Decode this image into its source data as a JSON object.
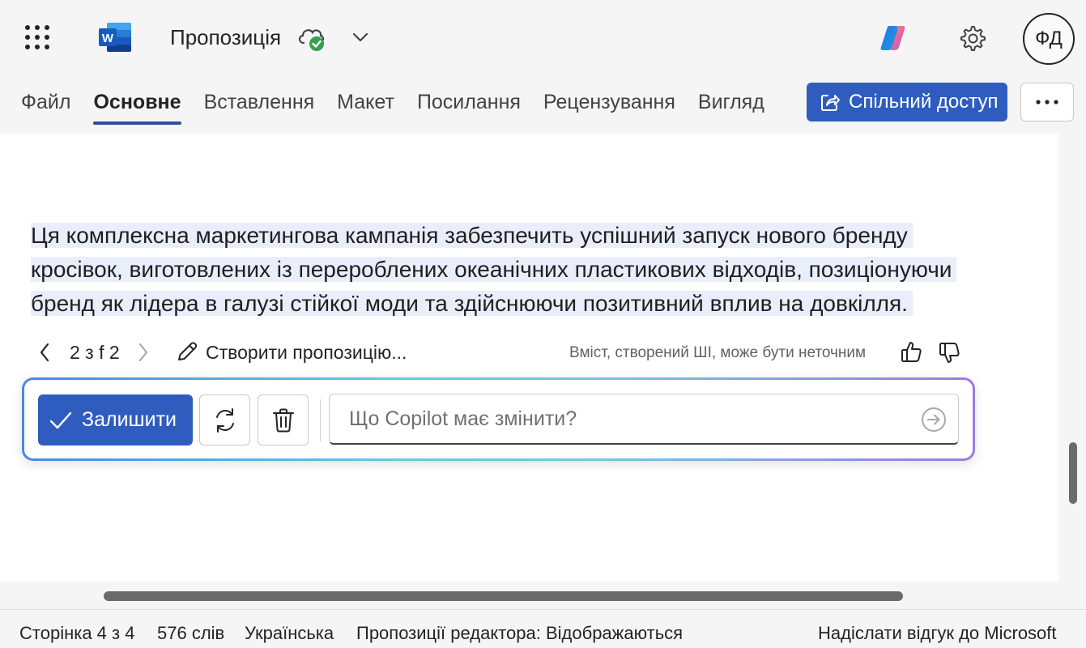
{
  "app": {
    "doc_title": "Пропозиція",
    "user_initials": "ФД"
  },
  "ribbon": {
    "tabs": [
      {
        "label": "Файл",
        "active": false
      },
      {
        "label": "Основне",
        "active": true
      },
      {
        "label": "Вставлення",
        "active": false
      },
      {
        "label": "Макет",
        "active": false
      },
      {
        "label": "Посилання",
        "active": false
      },
      {
        "label": "Рецензування",
        "active": false
      },
      {
        "label": "Вигляд",
        "active": false
      }
    ],
    "share_label": "Спільний доступ"
  },
  "document": {
    "paragraph_lines": [
      "Ця комплексна маркетингова кампанія забезпечить успішний запуск нового бренду",
      "кросівок, виготовлених із перероблених океанічних пластикових відходів, позиціонуючи",
      "бренд як лідера в галузі стійкої моди та здійснюючи позитивний вплив на довкілля."
    ]
  },
  "suggestion_nav": {
    "counter": "2 з f 2",
    "create_label": "Створити пропозицію...",
    "disclaimer": "Вміст, створений ШІ, може бути неточним"
  },
  "copilot_bar": {
    "keep_label": "Залишити",
    "input_placeholder": "Що Copilot має змінити?",
    "input_value": ""
  },
  "status": {
    "page": "Сторінка 4 з 4",
    "words": "576 слів",
    "language": "Українська",
    "editor": "Пропозиції редактора: Відображаються",
    "feedback": "Надіслати відгук до Microsoft"
  },
  "colors": {
    "accent": "#2f5dbf",
    "tab_underline": "#2f4f99",
    "selection": "#e9eefa",
    "sync_ok": "#3a9e4f"
  },
  "icons": {
    "app_launcher": "waffle-icon",
    "word": "word-logo-icon",
    "saved_state": "cloud-check-icon",
    "copilot": "copilot-icon",
    "settings": "gear-icon"
  }
}
